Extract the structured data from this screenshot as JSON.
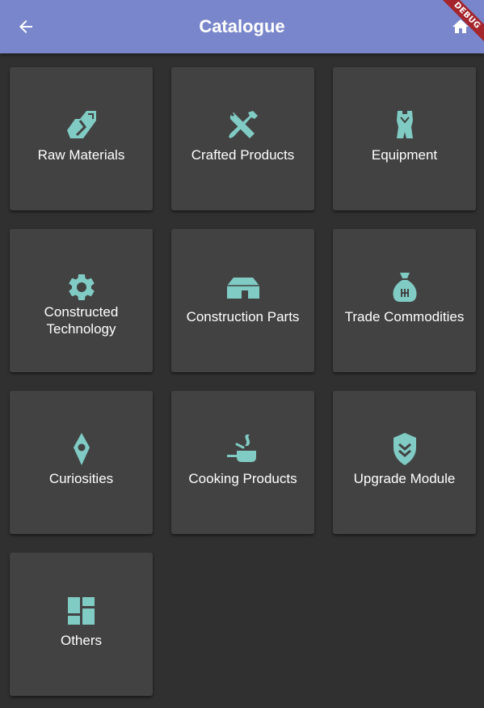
{
  "appbar": {
    "title": "Catalogue",
    "back_icon": "arrow-left-icon",
    "home_icon": "home-icon",
    "color": "#7986cb"
  },
  "debug_banner": "DEBUG",
  "accent_color": "#80cbc4",
  "categories": [
    {
      "label": "Raw Materials",
      "icon": "raw-materials-icon"
    },
    {
      "label": "Crafted Products",
      "icon": "tools-icon"
    },
    {
      "label": "Equipment",
      "icon": "exosuit-icon"
    },
    {
      "label": "Constructed Technology",
      "icon": "gear-icon"
    },
    {
      "label": "Construction Parts",
      "icon": "structure-icon"
    },
    {
      "label": "Trade Commodities",
      "icon": "bag-icon"
    },
    {
      "label": "Curiosities",
      "icon": "curiosity-icon"
    },
    {
      "label": "Cooking Products",
      "icon": "cooking-icon"
    },
    {
      "label": "Upgrade Module",
      "icon": "upgrade-shield-icon"
    },
    {
      "label": "Others",
      "icon": "others-grid-icon"
    }
  ]
}
